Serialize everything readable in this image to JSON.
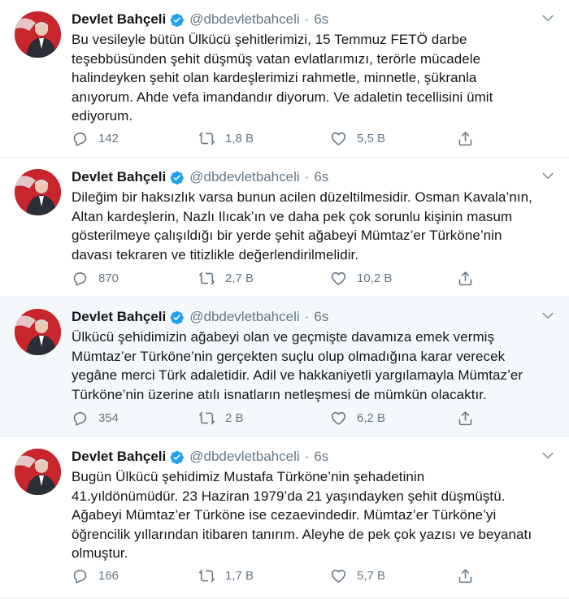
{
  "colors": {
    "verified": "#1da1f2",
    "muted": "#657786",
    "text": "#14171a",
    "divider": "#e6ecf0",
    "hover_bg": "#f5f8fa"
  },
  "icons": {
    "reply": "reply-icon",
    "retweet": "retweet-icon",
    "like": "heart-icon",
    "share": "share-icon",
    "verified": "verified-badge-icon",
    "menu": "chevron-down-icon"
  },
  "tweets": [
    {
      "name": "Devlet Bahçeli",
      "handle": "@dbdevletbahceli",
      "dot": "·",
      "time": "6s",
      "text": "Bu vesileyle bütün Ülkücü şehitlerimizi, 15 Temmuz FETÖ darbe\nteşebbüsünden şehit düşmüş vatan evlatlarımızı, terörle mücadele\nhalindeyken şehit olan kardeşlerimizi rahmetle, minnetle, şükranla\nanıyorum. Ahde vefa imandandır diyorum. Ve adaletin tecellisini ümit\nediyorum.",
      "replies": "142",
      "retweets": "1,8 B",
      "likes": "5,5 B"
    },
    {
      "name": "Devlet Bahçeli",
      "handle": "@dbdevletbahceli",
      "dot": "·",
      "time": "6s",
      "text": "Dileğim bir haksızlık varsa bunun acilen düzeltilmesidir. Osman Kavala’nın,\nAltan kardeşlerin, Nazlı Ilıcak’ın ve daha pek çok sorunlu kişinin masum\ngösterilmeye çalışıldığı bir yerde şehit ağabeyi Mümtaz’er Türköne’nin\ndavası tekraren ve titizlikle değerlendirilmelidir.",
      "replies": "870",
      "retweets": "2,7 B",
      "likes": "10,2 B"
    },
    {
      "name": "Devlet Bahçeli",
      "handle": "@dbdevletbahceli",
      "dot": "·",
      "time": "6s",
      "text": "Ülkücü şehidimizin ağabeyi olan ve geçmişte davamıza emek vermiş\nMümtaz’er Türköne’nin gerçekten suçlu olup olmadığına karar verecek\nyegâne merci Türk adaletidir. Adil ve hakkaniyetli yargılamayla Mümtaz’er\nTürköne’nin üzerine atılı isnatların netleşmesi de mümkün olacaktır.",
      "replies": "354",
      "retweets": "2 B",
      "likes": "6,2 B"
    },
    {
      "name": "Devlet Bahçeli",
      "handle": "@dbdevletbahceli",
      "dot": "·",
      "time": "6s",
      "text": "Bugün Ülkücü şehidimiz Mustafa Türköne’nin şehadetinin\n41.yıldönümüdür. 23 Haziran 1979’da 21 yaşındayken şehit düşmüştü.\nAğabeyi Mümtaz’er Türköne ise cezaevindedir. Mümtaz’er Türköne’yi\nöğrencilik yıllarından itibaren tanırım. Aleyhe de pek çok yazısı ve beyanatı\nolmuştur.",
      "replies": "166",
      "retweets": "1,7 B",
      "likes": "5,7 B"
    }
  ]
}
